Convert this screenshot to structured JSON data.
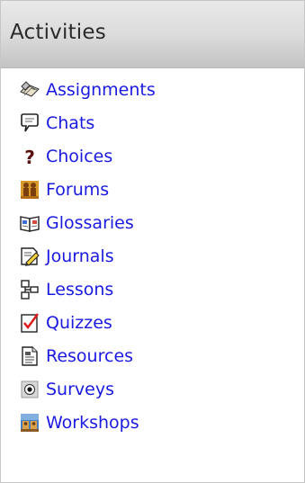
{
  "block": {
    "title": "Activities",
    "link_color": "#1a1ae0",
    "items": [
      {
        "label": "Assignments",
        "icon": "assignment-icon"
      },
      {
        "label": "Chats",
        "icon": "chat-icon"
      },
      {
        "label": "Choices",
        "icon": "choice-icon"
      },
      {
        "label": "Forums",
        "icon": "forum-icon"
      },
      {
        "label": "Glossaries",
        "icon": "glossary-icon"
      },
      {
        "label": "Journals",
        "icon": "journal-icon"
      },
      {
        "label": "Lessons",
        "icon": "lesson-icon"
      },
      {
        "label": "Quizzes",
        "icon": "quiz-icon"
      },
      {
        "label": "Resources",
        "icon": "resource-icon"
      },
      {
        "label": "Surveys",
        "icon": "survey-icon"
      },
      {
        "label": "Workshops",
        "icon": "workshop-icon"
      }
    ]
  }
}
